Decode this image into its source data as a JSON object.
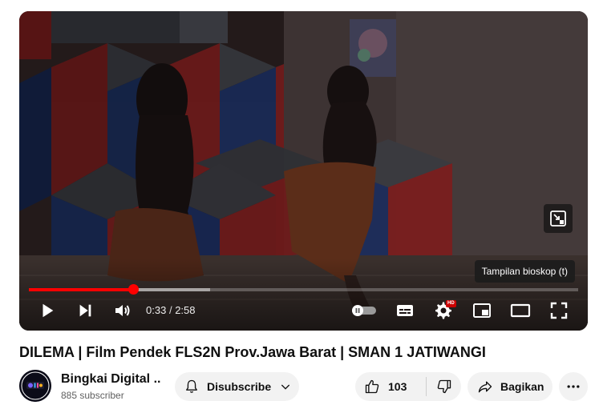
{
  "player": {
    "tooltip": "Tampilan bioskop (t)",
    "time_current": "0:33",
    "time_separator": "/",
    "time_total": "2:58",
    "progress_played_fraction": 0.19,
    "progress_buffered_fraction": 0.33,
    "quality_badge": "HD",
    "icons": [
      "play-icon",
      "next-icon",
      "volume-icon",
      "autoplay-toggle-icon",
      "subtitles-icon",
      "settings-icon",
      "miniplayer-icon",
      "theater-mode-icon",
      "fullscreen-icon",
      "cinema-exit-icon"
    ]
  },
  "video": {
    "title": "DILEMA | Film Pendek FLS2N Prov.Jawa Barat | SMAN 1 JATIWANGI"
  },
  "channel": {
    "name": "Bingkai Digital ...",
    "subscribers": "885 subscriber"
  },
  "actions": {
    "subscribe_label": "Disubscribe",
    "like_count": "103",
    "share_label": "Bagikan"
  },
  "colors": {
    "accent": "#ff0000",
    "pill_bg": "#f2f2f2",
    "text": "#0f0f0f",
    "secondary_text": "#606060"
  }
}
